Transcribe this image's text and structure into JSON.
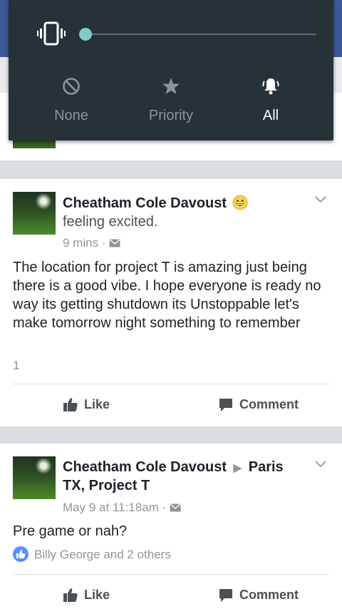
{
  "interruption_panel": {
    "volume_level": 0,
    "modes": [
      {
        "label": "None",
        "icon": "block-icon",
        "active": false
      },
      {
        "label": "Priority",
        "icon": "star-icon",
        "active": false
      },
      {
        "label": "All",
        "icon": "bell-icon",
        "active": true
      }
    ],
    "accent_color": "#80cbc4"
  },
  "posts": [
    {
      "author": "Cheatham Cole Davoust",
      "feeling": "feeling excited.",
      "feeling_icon": "grinning-face-icon",
      "time": "9 mins",
      "privacy_icon": "envelope-icon",
      "text": "The location for project T is amazing  just being there is a good vibe.  I hope everyone is ready no way its getting shutdown its Unstoppable let's make tomorrow night something to remember",
      "reaction_count": "1",
      "like_label": "Like",
      "comment_label": "Comment"
    },
    {
      "author": "Cheatham Cole Davoust",
      "location_line1": "Paris",
      "location_line2": "TX, Project T",
      "time": "May 9 at 11:18am",
      "privacy_icon": "envelope-icon",
      "text": "Pre game or nah?",
      "likers": "Billy George and 2 others",
      "like_label": "Like",
      "comment_label": "Comment"
    }
  ],
  "colors": {
    "facebook_blue": "#3b5998",
    "like_blue": "#5890ff"
  }
}
